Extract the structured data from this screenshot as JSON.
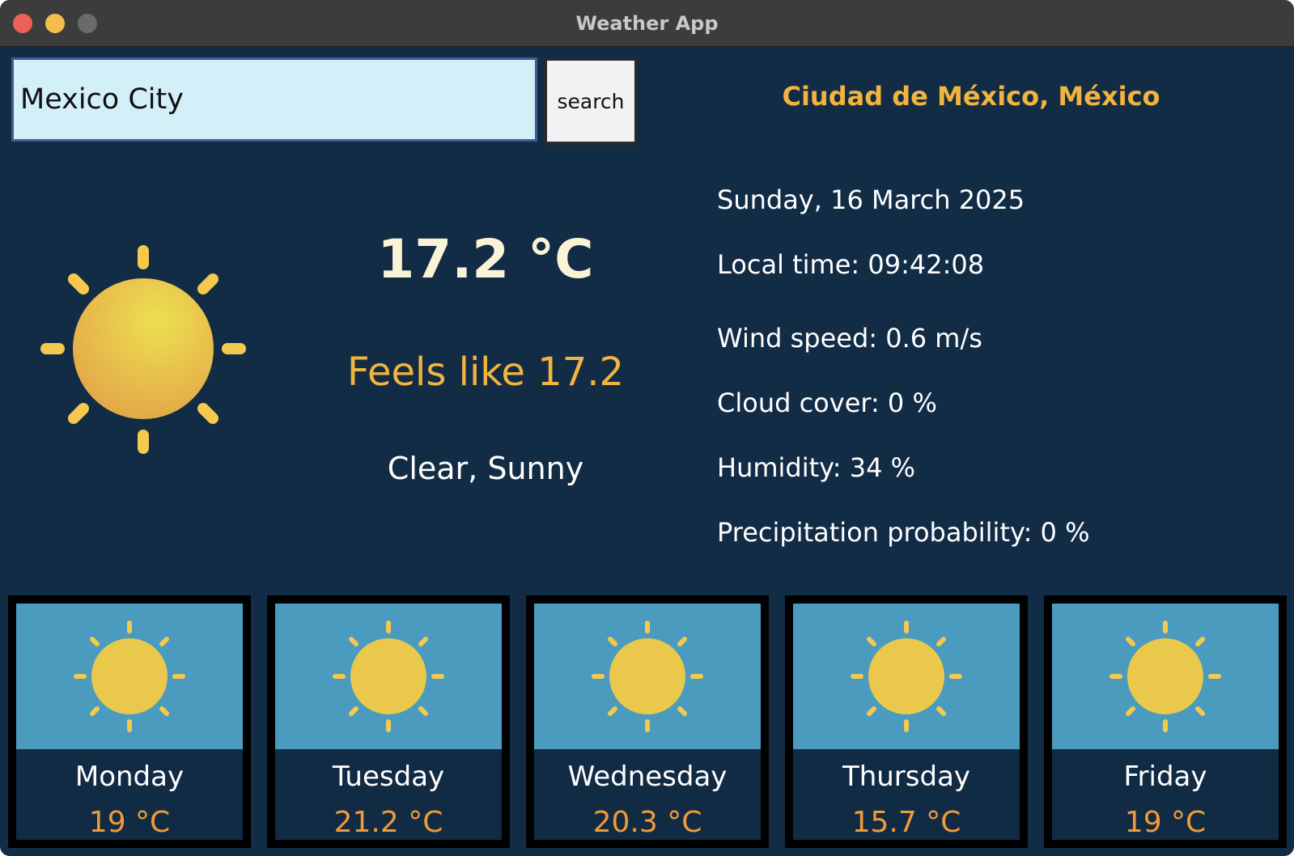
{
  "window": {
    "title": "Weather App"
  },
  "search": {
    "value": "Mexico City",
    "button_label": "search"
  },
  "location": "Ciudad de México, México",
  "current": {
    "icon": "sun-icon",
    "temperature": "17.2 °C",
    "feels_like": "Feels like 17.2",
    "condition": "Clear, Sunny"
  },
  "details": {
    "date": "Sunday, 16 March 2025",
    "local_time": "Local time: 09:42:08",
    "wind_speed": "Wind speed: 0.6 m/s",
    "cloud_cover": "Cloud cover: 0 %",
    "humidity": "Humidity: 34 %",
    "precipitation": "Precipitation probability: 0 %"
  },
  "forecast": [
    {
      "day": "Monday",
      "temp": "19 °C",
      "icon": "sun-icon"
    },
    {
      "day": "Tuesday",
      "temp": "21.2 °C",
      "icon": "sun-icon"
    },
    {
      "day": "Wednesday",
      "temp": "20.3 °C",
      "icon": "sun-icon"
    },
    {
      "day": "Thursday",
      "temp": "15.7 °C",
      "icon": "sun-icon"
    },
    {
      "day": "Friday",
      "temp": "19 °C",
      "icon": "sun-icon"
    }
  ],
  "colors": {
    "background": "#132c46",
    "accent": "#f1b43d",
    "forecast_temp": "#f19a38",
    "forecast_icon_bg": "#4a9bbe"
  }
}
